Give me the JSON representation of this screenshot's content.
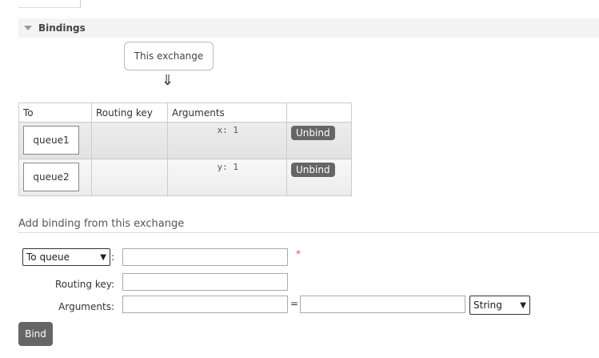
{
  "section": {
    "title": "Bindings"
  },
  "graph": {
    "exchange_label": "This exchange",
    "arrow": "⇓"
  },
  "table": {
    "headers": [
      "To",
      "Routing key",
      "Arguments",
      ""
    ],
    "rows": [
      {
        "to": "queue1",
        "routing_key": "",
        "arguments": "x: 1",
        "action": "Unbind"
      },
      {
        "to": "queue2",
        "routing_key": "",
        "arguments": "y: 1",
        "action": "Unbind"
      }
    ]
  },
  "add_binding": {
    "heading": "Add binding from this exchange",
    "destination_type": "To queue",
    "destination_colon": ":",
    "required_marker": "*",
    "destination_value": "",
    "routing_key_label": "Routing key:",
    "routing_key_value": "",
    "arguments_label": "Arguments:",
    "arg_key_value": "",
    "equals": "=",
    "arg_value": "",
    "arg_type": "String",
    "bind_label": "Bind"
  }
}
